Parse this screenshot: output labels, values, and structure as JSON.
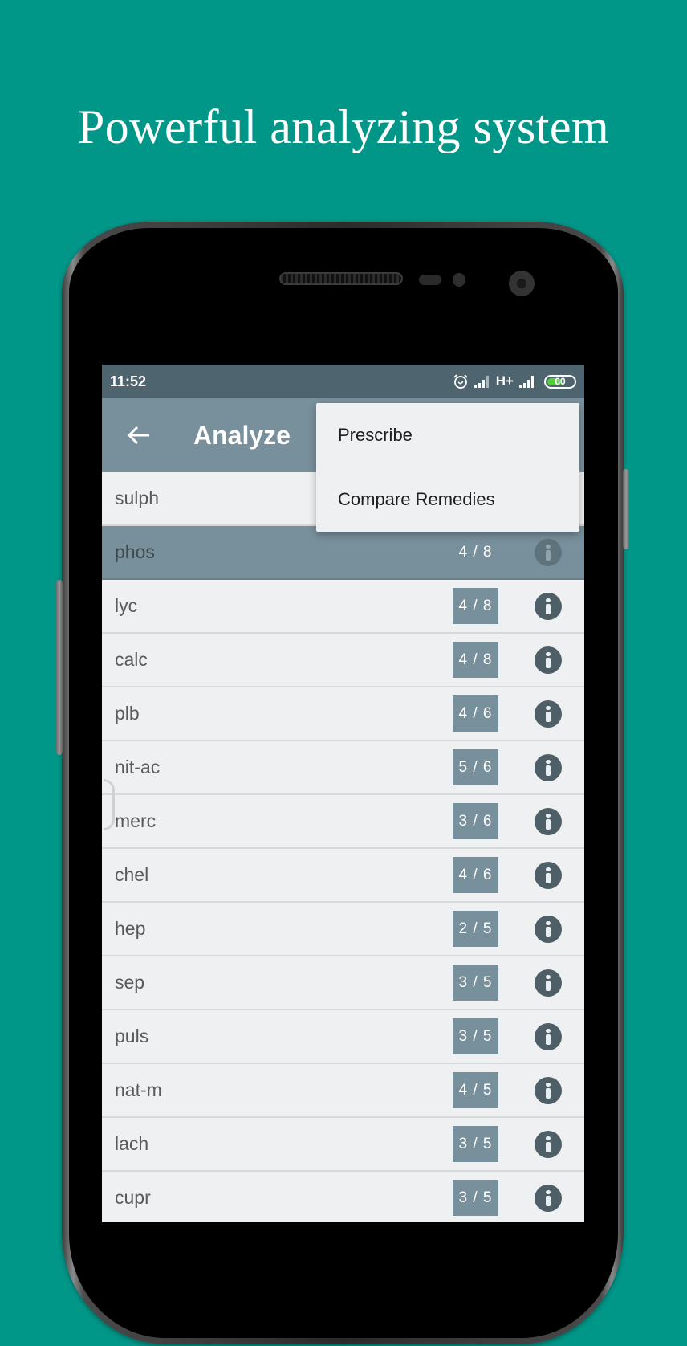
{
  "headline": "Powerful analyzing system",
  "status_bar": {
    "time": "11:52",
    "network": "H+",
    "battery": "60",
    "battery_level_percent": 60,
    "icons": [
      "alarm-icon",
      "signal-icon",
      "signal-icon",
      "battery-icon"
    ]
  },
  "app_bar": {
    "back_icon": "arrow-left-icon",
    "title": "Analyze"
  },
  "menu": {
    "items": [
      {
        "label": "Prescribe"
      },
      {
        "label": "Compare Remedies"
      }
    ]
  },
  "remedies": [
    {
      "name": "sulph",
      "score": "",
      "selected": false
    },
    {
      "name": "phos",
      "score": "4 / 8",
      "selected": true
    },
    {
      "name": "lyc",
      "score": "4 / 8",
      "selected": false
    },
    {
      "name": "calc",
      "score": "4 / 8",
      "selected": false
    },
    {
      "name": "plb",
      "score": "4 / 6",
      "selected": false
    },
    {
      "name": "nit-ac",
      "score": "5 / 6",
      "selected": false
    },
    {
      "name": "merc",
      "score": "3 / 6",
      "selected": false
    },
    {
      "name": "chel",
      "score": "4 / 6",
      "selected": false
    },
    {
      "name": "hep",
      "score": "2 / 5",
      "selected": false
    },
    {
      "name": "sep",
      "score": "3 / 5",
      "selected": false
    },
    {
      "name": "puls",
      "score": "3 / 5",
      "selected": false
    },
    {
      "name": "nat-m",
      "score": "4 / 5",
      "selected": false
    },
    {
      "name": "lach",
      "score": "3 / 5",
      "selected": false
    },
    {
      "name": "cupr",
      "score": "3 / 5",
      "selected": false
    }
  ],
  "colors": {
    "background": "#009688",
    "status_bar": "#4e646e",
    "app_bar": "#78909c",
    "score_badge": "#78909c",
    "info_icon": "#4e5f68",
    "list_bg": "#eff0f1",
    "battery_fill": "#4cd137"
  }
}
